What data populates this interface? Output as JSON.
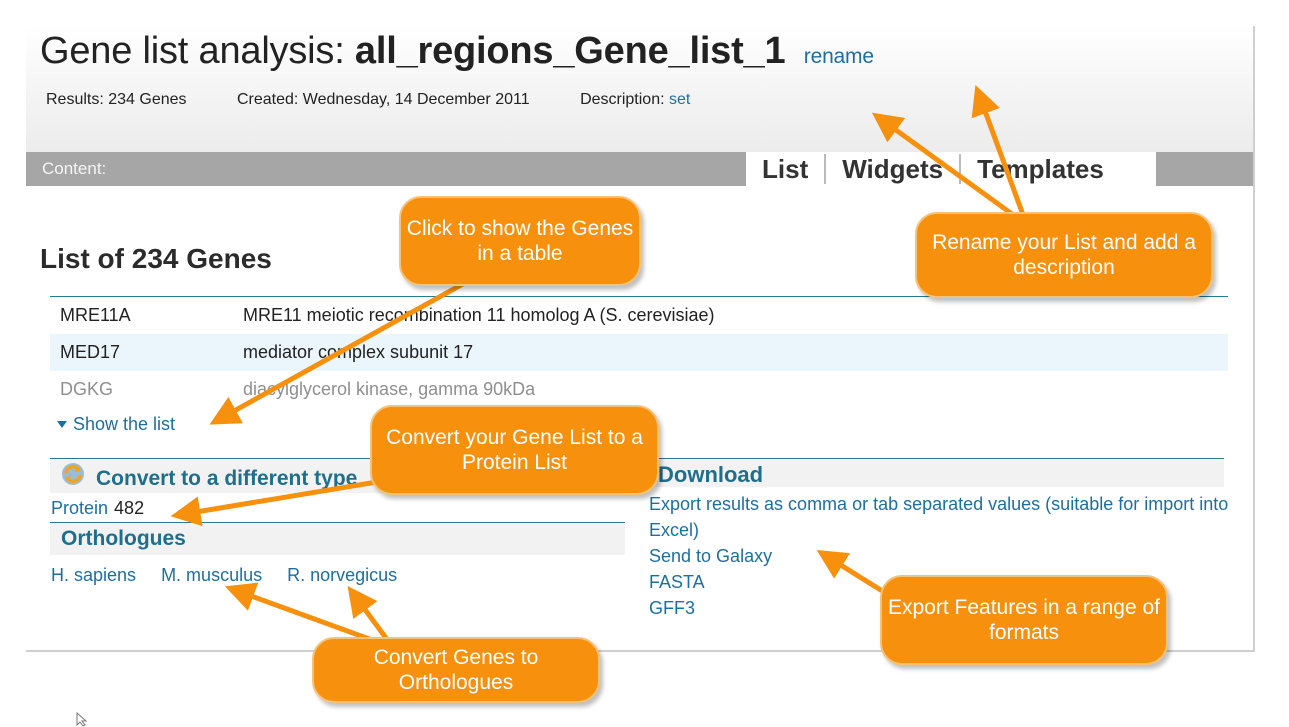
{
  "header": {
    "title_prefix": "Gene list analysis: ",
    "list_name": "all_regions_Gene_list_1",
    "rename_label": "rename",
    "results": "Results: 234 Genes",
    "created": "Created: Wednesday, 14 December 2011",
    "description_label": "Description: ",
    "description_link": "set"
  },
  "content_bar": {
    "label": "Content:",
    "tabs": [
      "List",
      "Widgets",
      "Templates"
    ]
  },
  "list": {
    "heading": "List of 234 Genes",
    "rows": [
      {
        "symbol": "MRE11A",
        "description": "MRE11 meiotic recombination 11 homolog A (S. cerevisiae)"
      },
      {
        "symbol": "MED17",
        "description": "mediator complex subunit 17"
      },
      {
        "symbol": "DGKG",
        "description": "diacylglycerol kinase, gamma 90kDa"
      }
    ],
    "show_list": "Show the list"
  },
  "convert": {
    "heading": "Convert to a different type",
    "icon": "refresh-icon",
    "protein_label": "Protein",
    "protein_count": "482"
  },
  "orthologues": {
    "heading": "Orthologues",
    "links": [
      "H. sapiens",
      "M. musculus",
      "R. norvegicus"
    ]
  },
  "download": {
    "heading": "Download",
    "links": [
      "Export results as comma or tab separated values (suitable for import into Excel)",
      "Send to Galaxy",
      "FASTA",
      "GFF3"
    ]
  },
  "callouts": {
    "show_table": "Click to show the Genes in a table",
    "rename": "Rename your List and add a description",
    "convert_protein": "Convert your Gene List to a Protein List",
    "orthologues": "Convert Genes to Orthologues",
    "export": "Export Features in a range of formats"
  },
  "colors": {
    "callout": "#f7900d",
    "link": "#1d6f9f",
    "section_heading": "#1f6f8c",
    "content_bar": "#a6a6a6"
  }
}
